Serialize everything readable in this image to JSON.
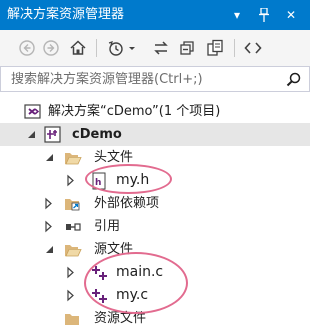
{
  "window": {
    "title": "解决方案资源管理器",
    "buttons": [
      "▾",
      "⊥",
      "✕"
    ]
  },
  "toolbar": {
    "icons": [
      "back-icon",
      "forward-icon",
      "home-icon",
      "history-icon",
      "sync-icon",
      "collapse-icon",
      "copy-icon",
      "code-icon"
    ]
  },
  "search": {
    "placeholder": "搜索解决方案资源管理器(Ctrl+;)"
  },
  "tree": {
    "solution": "解决方案“cDemo”(1 个项目)",
    "project": "cDemo",
    "header_folder": "头文件",
    "header_file": "my.h",
    "external_deps": "外部依赖项",
    "references": "引用",
    "source_folder": "源文件",
    "source_files": [
      "main.c",
      "my.c"
    ],
    "resource_folder": "资源文件"
  },
  "colors": {
    "accent": "#007acc",
    "annotation": "#e26b8f",
    "folder": "#dcb67a",
    "cpp": "#68217a"
  }
}
